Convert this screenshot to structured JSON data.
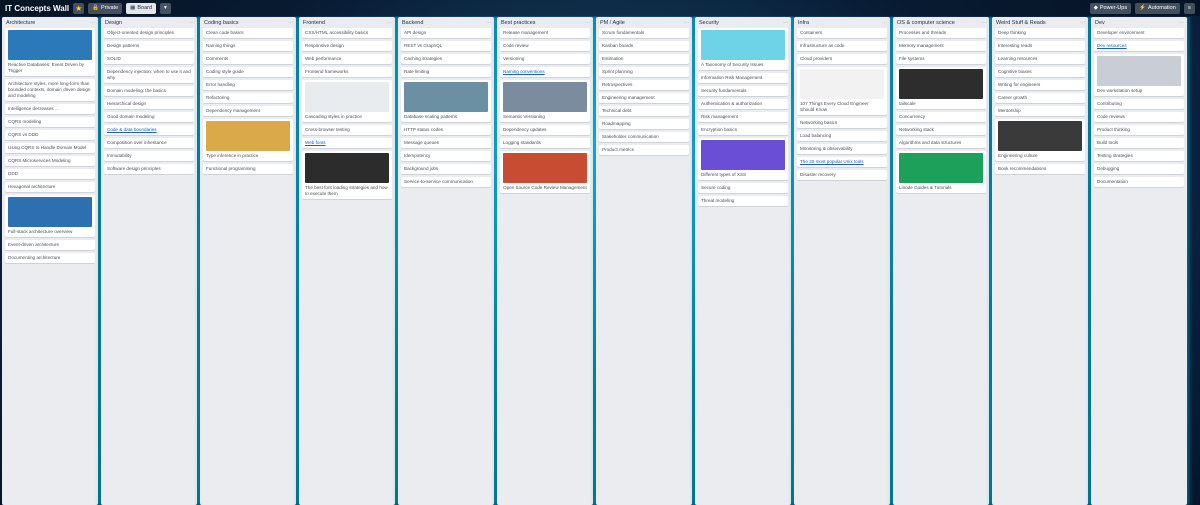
{
  "board": {
    "title": "IT Concepts Wall",
    "visibility_label": "Private",
    "view_label": "Board",
    "powerups_label": "Power-Ups",
    "automation_label": "Automation"
  },
  "lists": [
    {
      "title": "Architecture",
      "cards": [
        {
          "img": "#2b79b8",
          "text": "Reactive Databases: Event Driven by Trigger"
        },
        {
          "text": "Architecture styles, more long-form than bounded contexts, domain driven design and modeling"
        },
        {
          "text": "Intelligence decreases ..."
        },
        {
          "text": "CQRS modeling"
        },
        {
          "text": "CQRS vs DDD"
        },
        {
          "text": "Using CQRS to Handle Domain Model"
        },
        {
          "text": "CQRS Microservices Modeling"
        },
        {
          "text": "DDD"
        },
        {
          "text": "Hexagonal architecture"
        },
        {
          "img": "#2d6fb0",
          "text": "Full-stack architecture overview"
        },
        {
          "text": "Event-driven architecture"
        },
        {
          "text": "Documenting architecture"
        }
      ]
    },
    {
      "title": "Design",
      "cards": [
        {
          "text": "Object-oriented design principles"
        },
        {
          "text": "Design patterns"
        },
        {
          "text": "SOLID"
        },
        {
          "text": "Dependency injection: when to use it and why"
        },
        {
          "text": "Domain modeling: the basics"
        },
        {
          "text": "Hierarchical design"
        },
        {
          "text": "Good domain modeling"
        },
        {
          "text": "Code & data boundaries",
          "link": true
        },
        {
          "text": "Composition over inheritance"
        },
        {
          "text": "Immutability"
        },
        {
          "text": "Software design principles"
        }
      ]
    },
    {
      "title": "Coding basics",
      "cards": [
        {
          "text": "Clean code basics"
        },
        {
          "text": "Naming things"
        },
        {
          "text": "Comments"
        },
        {
          "text": "Coding style guide"
        },
        {
          "text": "Error handling"
        },
        {
          "text": "Refactoring"
        },
        {
          "text": "Dependency management"
        },
        {
          "img": "#d9a94a",
          "text": "Type inference in practice"
        },
        {
          "text": "Functional programming"
        }
      ]
    },
    {
      "title": "Frontend",
      "cards": [
        {
          "text": "CSS/HTML accessibility basics"
        },
        {
          "text": "Responsive design"
        },
        {
          "text": "Web performance"
        },
        {
          "text": "Frontend frameworks"
        },
        {
          "img": "#e9ecef",
          "text": "Cascading styles in practice"
        },
        {
          "text": "Cross-browser testing"
        },
        {
          "text": "Web fonts",
          "link": true
        },
        {
          "img": "#2c2c2c",
          "text": "The best font loading strategies and how to execute them"
        }
      ]
    },
    {
      "title": "Backend",
      "cards": [
        {
          "text": "API design"
        },
        {
          "text": "REST vs GraphQL"
        },
        {
          "text": "Caching strategies"
        },
        {
          "text": "Rate limiting"
        },
        {
          "img": "#6b8fa3",
          "text": "Database scaling patterns"
        },
        {
          "text": "HTTP status codes"
        },
        {
          "text": "Message queues"
        },
        {
          "text": "Idempotency"
        },
        {
          "text": "Background jobs"
        },
        {
          "text": "Service-to-service communication"
        }
      ]
    },
    {
      "title": "Best practices",
      "cards": [
        {
          "text": "Release management"
        },
        {
          "text": "Code review"
        },
        {
          "text": "Versioning"
        },
        {
          "text": "Naming conventions",
          "link": true
        },
        {
          "img": "#7a8c9e",
          "text": "Semantic Versioning"
        },
        {
          "text": "Dependency updates"
        },
        {
          "text": "Logging standards"
        },
        {
          "img": "#c84c32",
          "text": "Open Source Code Review Management"
        }
      ]
    },
    {
      "title": "PM / Agile",
      "cards": [
        {
          "text": "Scrum fundamentals"
        },
        {
          "text": "Kanban boards"
        },
        {
          "text": "Estimation"
        },
        {
          "text": "Sprint planning"
        },
        {
          "text": "Retrospectives"
        },
        {
          "text": "Engineering management"
        },
        {
          "text": "Technical debt"
        },
        {
          "text": "Roadmapping"
        },
        {
          "text": "Stakeholder communication"
        },
        {
          "text": "Product metrics"
        }
      ]
    },
    {
      "title": "Security",
      "cards": [
        {
          "img": "#6fd3e8",
          "text": "A Taxonomy of Security Issues"
        },
        {
          "text": "Information Risk Management"
        },
        {
          "text": "Security fundamentals"
        },
        {
          "text": "Authentication & authorization"
        },
        {
          "text": "Risk management"
        },
        {
          "text": "Encryption basics"
        },
        {
          "img": "#6a4fd6",
          "text": "Different types of XSS"
        },
        {
          "text": "Secure coding"
        },
        {
          "text": "Threat modeling"
        }
      ]
    },
    {
      "title": "Infra",
      "cards": [
        {
          "text": "Containers"
        },
        {
          "text": "Infrastructure as code"
        },
        {
          "text": "Cloud providers"
        },
        {
          "img": "#f2f2f2",
          "text": "107 Things Every Cloud Engineer Should Know"
        },
        {
          "text": "Networking basics"
        },
        {
          "text": "Load balancing"
        },
        {
          "text": "Monitoring & observability"
        },
        {
          "text": "The 20 most popular Unix tools",
          "link": true
        },
        {
          "text": "Disaster recovery"
        }
      ]
    },
    {
      "title": "OS & computer science",
      "cards": [
        {
          "text": "Processes and threads"
        },
        {
          "text": "Memory management"
        },
        {
          "text": "File systems"
        },
        {
          "img": "#2d2d2d",
          "text": "tailscale"
        },
        {
          "text": "Concurrency"
        },
        {
          "text": "Networking stack"
        },
        {
          "text": "Algorithms and data structures"
        },
        {
          "img": "#1da05a",
          "text": "Linode Guides & Tutorials"
        }
      ]
    },
    {
      "title": "Weird Stuff & Reads",
      "cards": [
        {
          "text": "Deep thinking"
        },
        {
          "text": "Interesting reads"
        },
        {
          "text": "Learning resources"
        },
        {
          "text": "Cognitive biases"
        },
        {
          "text": "Writing for engineers"
        },
        {
          "text": "Career growth"
        },
        {
          "text": "Mentorship"
        },
        {
          "img": "#3a3a3a",
          "text": "Engineering culture"
        },
        {
          "text": "Book recommendations"
        }
      ]
    },
    {
      "title": "Dev",
      "cards": [
        {
          "text": "Developer environment"
        },
        {
          "text": "Dev resources",
          "link": true
        },
        {
          "img": "#c9ced6",
          "text": "Dev workstation setup"
        },
        {
          "text": "Contributing"
        },
        {
          "text": "Code reviews"
        },
        {
          "text": "Product thinking"
        },
        {
          "text": "Build tools"
        },
        {
          "text": "Testing strategies"
        },
        {
          "text": "Debugging"
        },
        {
          "text": "Documentation"
        }
      ]
    }
  ]
}
